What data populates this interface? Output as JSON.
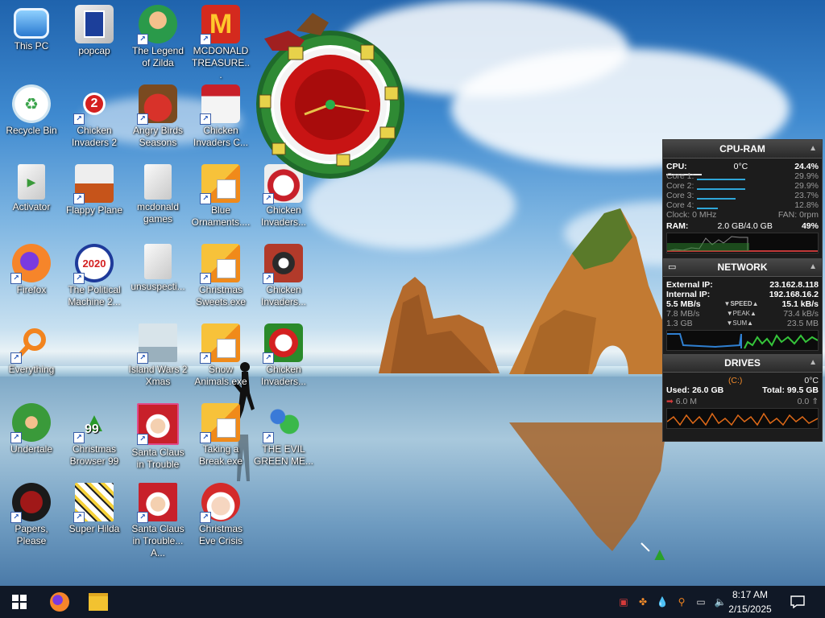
{
  "desktop": {
    "icons": [
      {
        "label": "This PC"
      },
      {
        "label": "popcap"
      },
      {
        "label": "The Legend of Zilda"
      },
      {
        "label": "MCDONALD TREASURE..."
      },
      {
        "label": "Recycle Bin"
      },
      {
        "label": "Chicken Invaders 2"
      },
      {
        "label": "Angry Birds Seasons"
      },
      {
        "label": "Chicken Invaders C..."
      },
      {
        "label": "Activator"
      },
      {
        "label": "Flappy Plane"
      },
      {
        "label": "mcdonald games"
      },
      {
        "label": "Blue Ornaments...."
      },
      {
        "label": "Chicken Invaders..."
      },
      {
        "label": "Firefox"
      },
      {
        "label": "The Political Machine 2..."
      },
      {
        "label": "unsuspecti..."
      },
      {
        "label": "Christmas Sweets.exe"
      },
      {
        "label": "Chicken Invaders..."
      },
      {
        "label": "Everything"
      },
      {
        "label": "Island Wars 2 Xmas"
      },
      {
        "label": "Snow Animals.exe"
      },
      {
        "label": "Chicken Invaders..."
      },
      {
        "label": "Undertale"
      },
      {
        "label": "Christmas Browser 99"
      },
      {
        "label": "Santa Claus in Trouble"
      },
      {
        "label": "Taking a Break.exe"
      },
      {
        "label": "THE EVIL GREEN ME..."
      },
      {
        "label": "Papers, Please"
      },
      {
        "label": "Super Hilda"
      },
      {
        "label": "Santa Claus in Trouble... A..."
      },
      {
        "label": "Christmas Eve Crisis"
      }
    ],
    "icon_text": {
      "political_badge": "2020",
      "browser_badge": "99",
      "chicken_badge": "2"
    }
  },
  "monitor": {
    "cpu_ram": {
      "title": "CPU-RAM",
      "cpu_label": "CPU:",
      "cpu_temp": "0°C",
      "cpu_total": "24.4%",
      "cores": [
        {
          "label": "Core 1:",
          "value": "29.9%",
          "level": 0.3
        },
        {
          "label": "Core 2:",
          "value": "29.9%",
          "level": 0.3
        },
        {
          "label": "Core 3:",
          "value": "23.7%",
          "level": 0.24
        },
        {
          "label": "Core 4:",
          "value": "12.8%",
          "level": 0.13
        }
      ],
      "clock": "Clock: 0 MHz",
      "fan": "FAN: 0rpm",
      "ram_label": "RAM:",
      "ram_used": "2.0 GB/4.0 GB",
      "ram_pct": "49%"
    },
    "network": {
      "title": "NETWORK",
      "external_label": "External IP:",
      "external_ip": "23.162.8.118",
      "internal_label": "Internal IP:",
      "internal_ip": "192.168.16.2",
      "speed_down": "5.5 MB/s",
      "speed_label": "SPEED",
      "speed_up": "15.1 kB/s",
      "peak_down": "7.8 MB/s",
      "peak_label": "PEAK",
      "peak_up": "73.4 kB/s",
      "sum_down": "1.3 GB",
      "sum_label": "SUM",
      "sum_up": "23.5 MB"
    },
    "drives": {
      "title": "DRIVES",
      "drive_name": "(C:)",
      "drive_temp": "0°C",
      "used": "Used: 26.0 GB",
      "total": "Total: 99.5 GB",
      "read": "6.0 M",
      "write": "0.0"
    }
  },
  "taskbar": {
    "time": "8:17 AM",
    "date": "2/15/2025"
  },
  "colors": {
    "taskbar": "#101826",
    "monitor_bg": "#1c1c1c",
    "net_down": "#2f7fd0",
    "net_up": "#35c43a",
    "drive_graph": "#e06a18"
  }
}
